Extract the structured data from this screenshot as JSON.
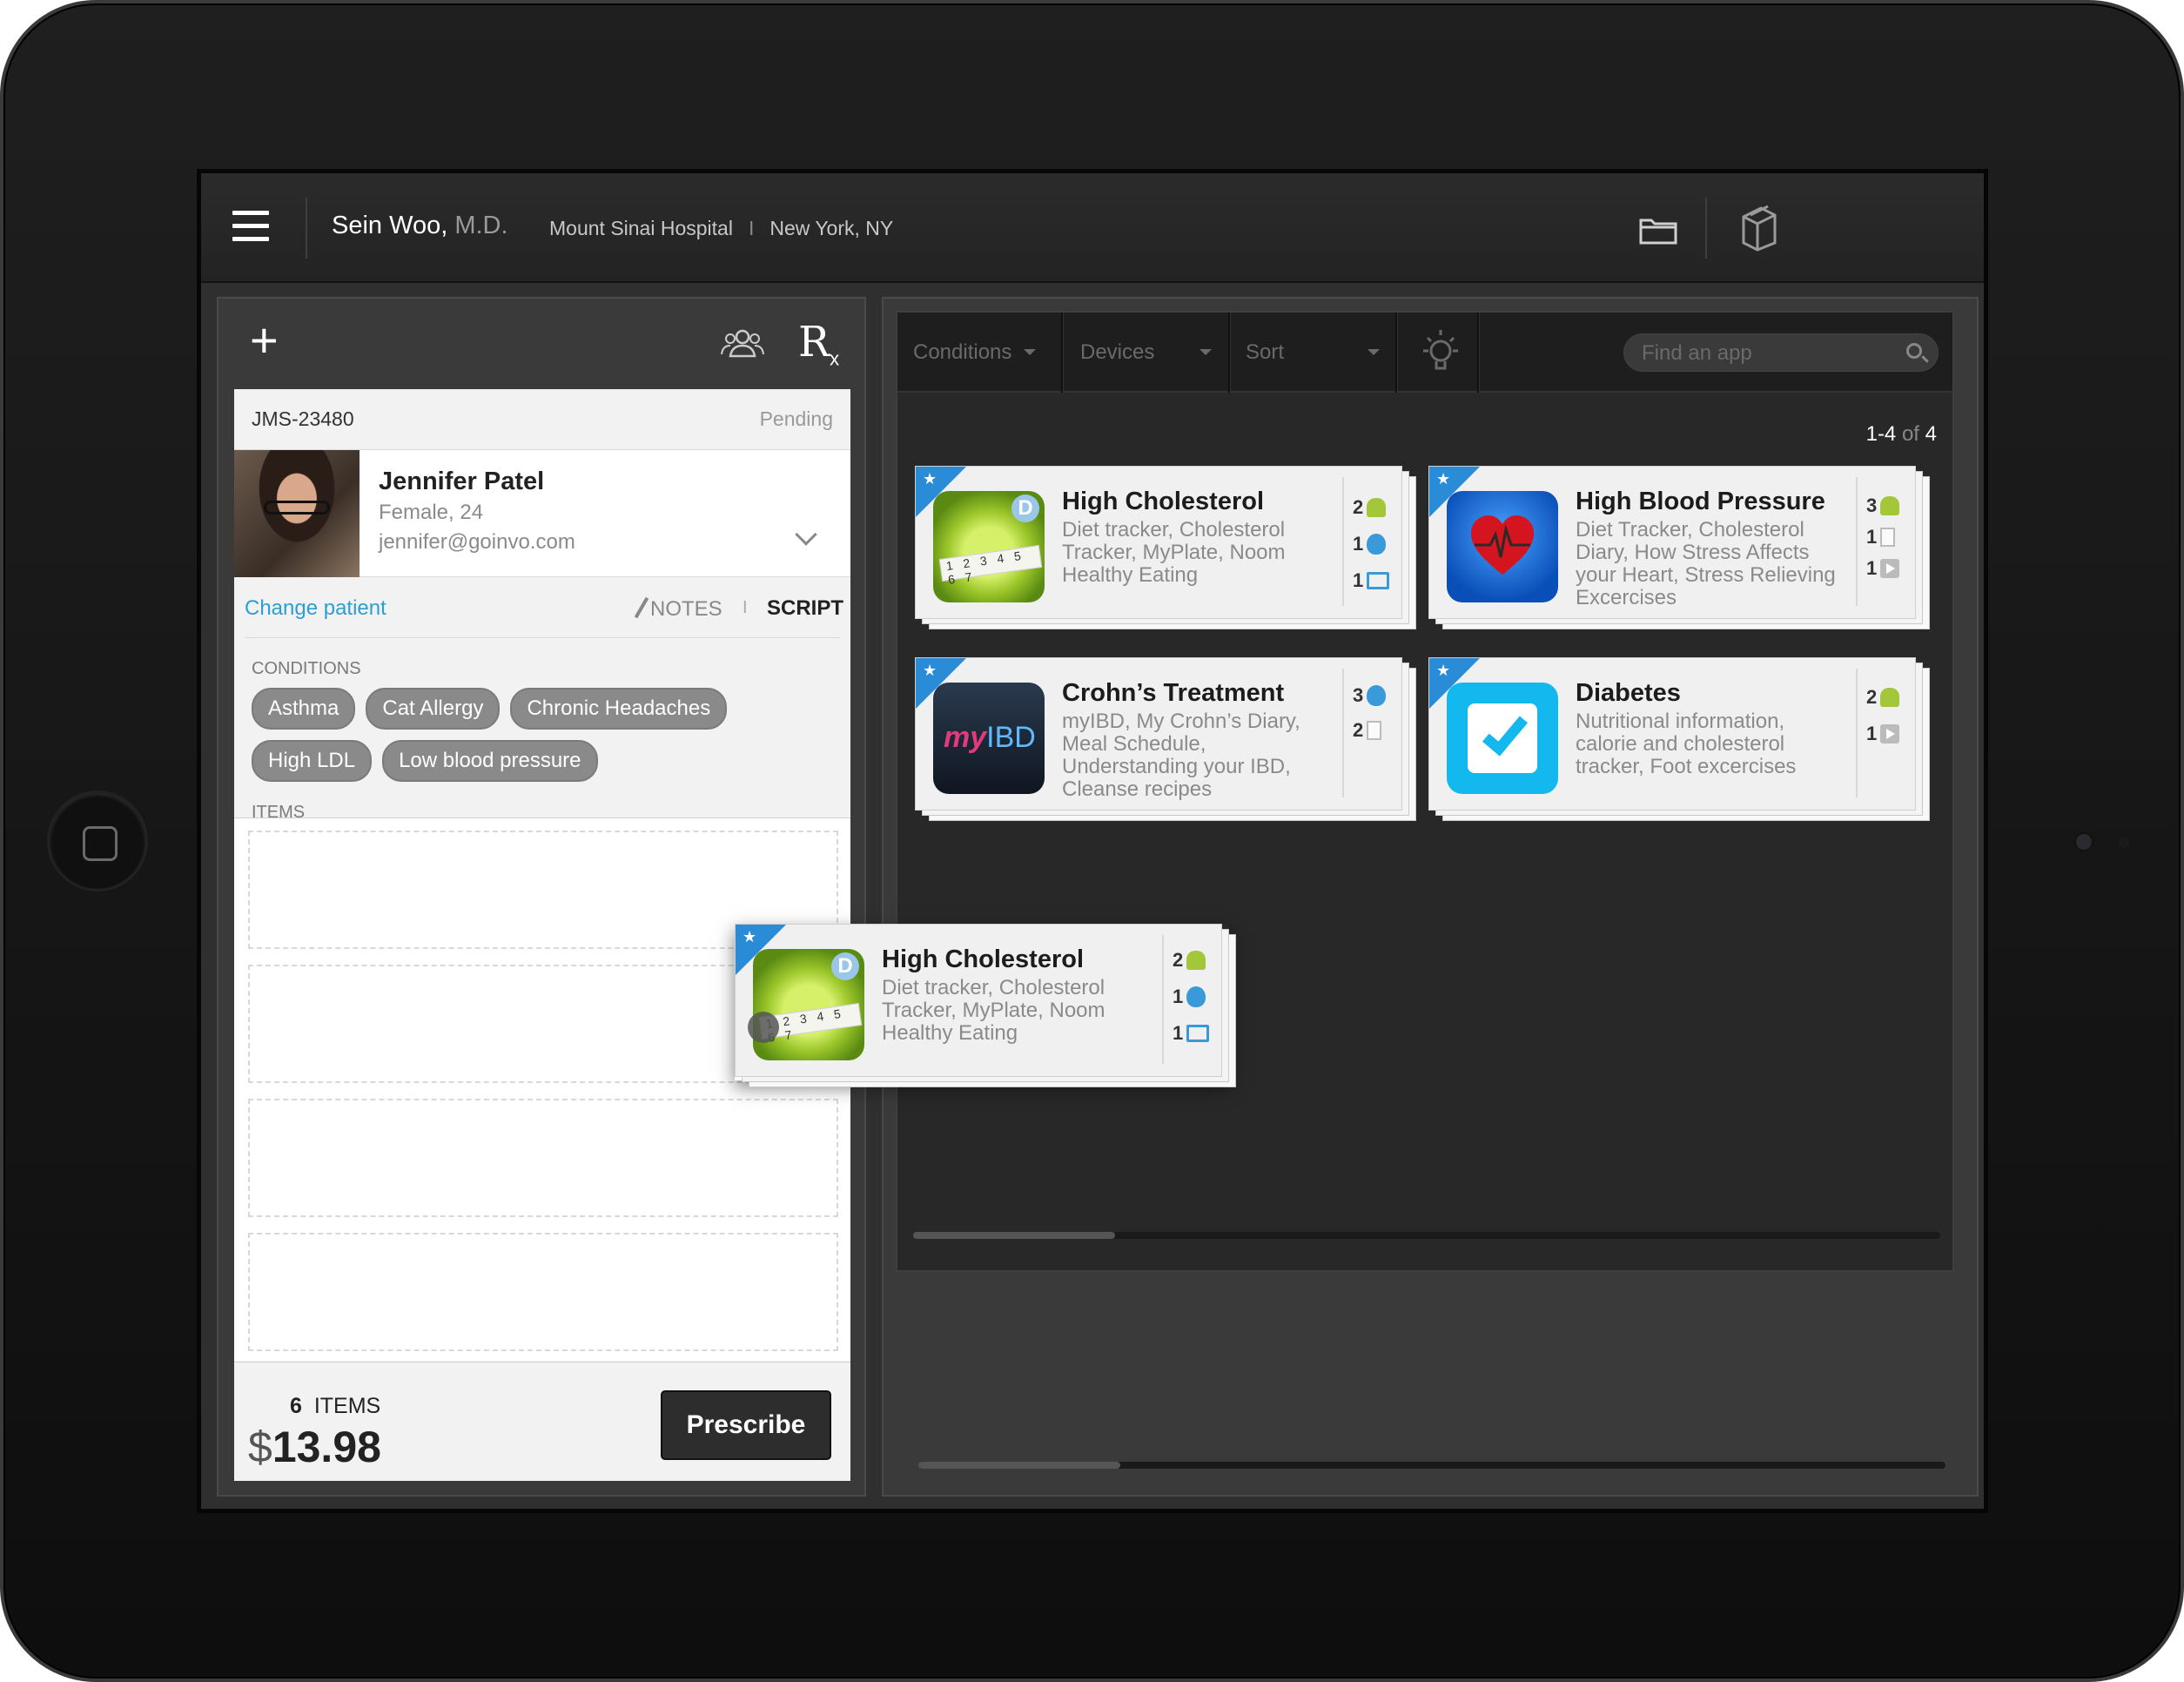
{
  "topbar": {
    "doctor_name": "Sein Woo,",
    "doctor_title": "M.D.",
    "hospital": "Mount Sinai Hospital",
    "separator": "I",
    "location": "New York, NY",
    "icons": [
      "menu-icon",
      "folder-icon",
      "books-icon"
    ]
  },
  "left": {
    "add_icon": "+",
    "rx_label": "R",
    "rx_sub": "x",
    "order": {
      "id": "JMS-23480",
      "status": "Pending"
    },
    "patient": {
      "name": "Jennifer Patel",
      "info": "Female, 24",
      "email": "jennifer@goinvo.com"
    },
    "actions": {
      "change": "Change patient",
      "notes": "NOTES",
      "sep": "I",
      "script": "SCRIPT"
    },
    "conditions_label": "CONDITIONS",
    "conditions": [
      "Asthma",
      "Cat Allergy",
      "Chronic Headaches",
      "High LDL",
      "Low blood pressure"
    ],
    "items_label": "ITEMS",
    "footer": {
      "count": "6",
      "count_label": "ITEMS",
      "currency": "$",
      "total": "13.98",
      "prescribe": "Prescribe"
    }
  },
  "right": {
    "filters": {
      "conditions": "Conditions",
      "devices": "Devices",
      "sort": "Sort",
      "search_placeholder": "Find an app"
    },
    "range": {
      "shown": "1-4",
      "of": "of",
      "total": "4"
    },
    "apps": [
      {
        "title": "High Cholesterol",
        "desc": "Diet tracker, Cholesterol Tracker, MyPlate, Noom Healthy Eating",
        "platforms": [
          {
            "n": "2",
            "icon": "android-icon"
          },
          {
            "n": "1",
            "icon": "apple-icon"
          },
          {
            "n": "1",
            "icon": "tablet-icon"
          }
        ]
      },
      {
        "title": "High Blood Pressure",
        "desc": "Diet Tracker, Cholesterol Diary, How Stress Affects your Heart, Stress Relieving Excercises",
        "platforms": [
          {
            "n": "3",
            "icon": "android-icon"
          },
          {
            "n": "1",
            "icon": "document-icon"
          },
          {
            "n": "1",
            "icon": "video-icon"
          }
        ]
      },
      {
        "title": "Crohn’s Treatment",
        "desc": "myIBD, My Crohn’s Diary, Meal Schedule, Understanding your IBD, Cleanse recipes",
        "platforms": [
          {
            "n": "3",
            "icon": "apple-icon"
          },
          {
            "n": "2",
            "icon": "document-icon"
          }
        ]
      },
      {
        "title": "Diabetes",
        "desc": "Nutritional information, calorie and cholesterol tracker, Foot excercises",
        "platforms": [
          {
            "n": "2",
            "icon": "android-icon"
          },
          {
            "n": "1",
            "icon": "video-icon"
          }
        ]
      }
    ],
    "dragging": {
      "title": "High Cholesterol",
      "desc": "Diet tracker, Cholesterol Tracker, MyPlate, Noom Healthy Eating",
      "platforms": [
        {
          "n": "2",
          "icon": "android-icon"
        },
        {
          "n": "1",
          "icon": "apple-icon"
        },
        {
          "n": "1",
          "icon": "tablet-icon"
        }
      ]
    },
    "icon_text": {
      "apple_badge": "D",
      "apple_tape": "1 2 3 4 5 6 7",
      "ibd_my": "my",
      "ibd_ibd": "IBD"
    }
  }
}
